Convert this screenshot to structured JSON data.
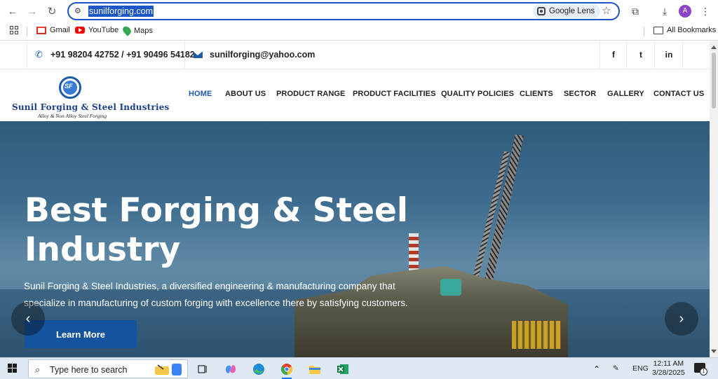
{
  "browser": {
    "url": "sunilforging.com",
    "lens_label": "Google Lens",
    "avatar_initial": "A",
    "bookmarks": [
      {
        "label": "Gmail",
        "icon": "gmail-icon"
      },
      {
        "label": "YouTube",
        "icon": "youtube-icon"
      },
      {
        "label": "Maps",
        "icon": "maps-icon"
      }
    ],
    "all_bookmarks_label": "All Bookmarks"
  },
  "site": {
    "topbar": {
      "phone": "+91 98204 42752 / +91 90496 54182",
      "email": "sunilforging@yahoo.com",
      "social": [
        "f",
        "t",
        "in"
      ]
    },
    "logo": {
      "mark_text": "SF",
      "title": "Sunil Forging & Steel Industries",
      "subtitle": "Alloy & Non Alloy Steel Forging"
    },
    "menu": [
      {
        "label": "HOME",
        "active": true
      },
      {
        "label": "ABOUT US",
        "active": false
      },
      {
        "label": "PRODUCT RANGE",
        "active": false
      },
      {
        "label": "PRODUCT FACILITIES",
        "active": false
      },
      {
        "label": "QUALITY POLICIES",
        "active": false
      },
      {
        "label": "CLIENTS",
        "active": false
      },
      {
        "label": "SECTOR",
        "active": false
      },
      {
        "label": "GALLERY",
        "active": false
      },
      {
        "label": "CONTACT US",
        "active": false
      }
    ],
    "hero": {
      "title": "Best Forging & Steel Industry",
      "description": "Sunil Forging & Steel Industries, a diversified engineering & manufacturing company that specialize in manufacturing of custom forging with excellence there by satisfying customers.",
      "button_label": "Learn More"
    },
    "accent_color": "#1d5aa8"
  },
  "taskbar": {
    "search_placeholder": "Type here to search",
    "language": "ENG",
    "time": "12:11 AM",
    "date": "3/28/2025",
    "notification_count": "1"
  }
}
